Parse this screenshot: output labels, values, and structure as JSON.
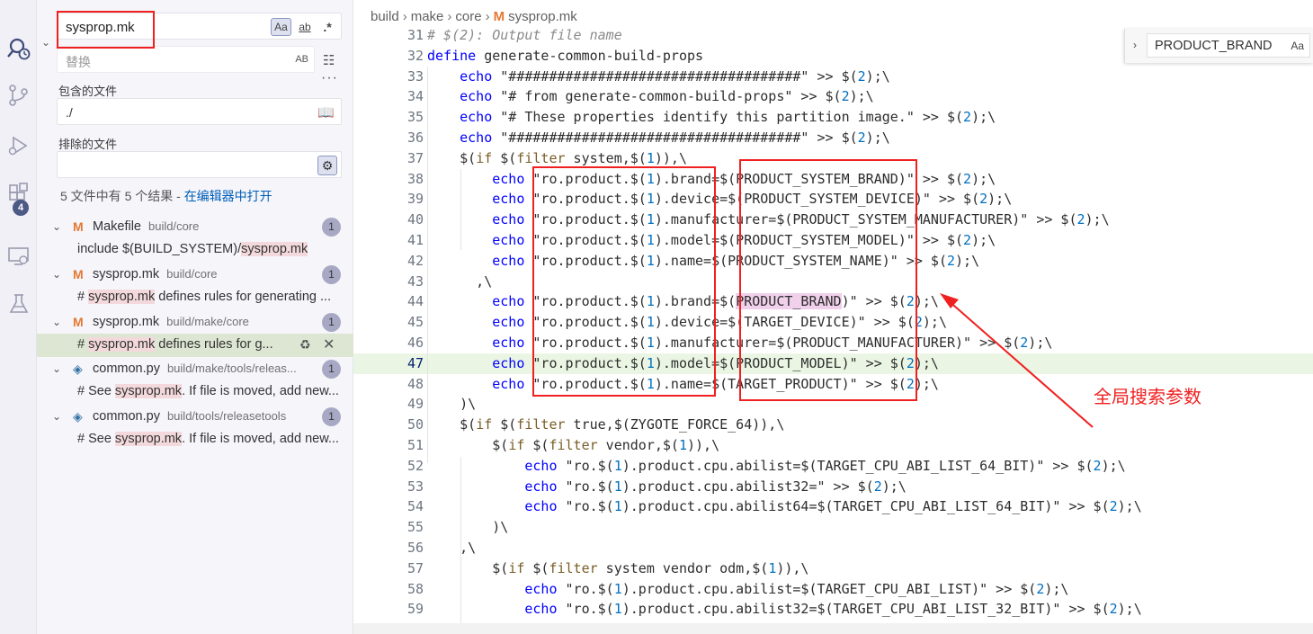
{
  "search": {
    "query": "sysprop.mk",
    "match_case_label": "Aa",
    "whole_word_label": "ab",
    "regex_label": ".*",
    "replace_placeholder": "替换",
    "preserve_case_label": "AB",
    "includes_label": "包含的文件",
    "includes_value": "./",
    "excludes_label": "排除的文件",
    "excludes_value": "",
    "summary_prefix": "5 文件中有 5 个结果 - ",
    "open_in_editor_label": "在编辑器中打开"
  },
  "activity_bar": {
    "icons": [
      "search-icon",
      "source-control-icon",
      "run-debug-icon",
      "extensions-icon",
      "remote-explorer-icon",
      "testing-icon"
    ],
    "extensions_badge": "4"
  },
  "results": [
    {
      "file": "Makefile",
      "path": "build/core",
      "count": "1",
      "type": "mk",
      "match_before": "include $(BUILD_SYSTEM)/",
      "match_hit": "sysprop.mk",
      "match_after": ""
    },
    {
      "file": "sysprop.mk",
      "path": "build/core",
      "count": "1",
      "type": "mk",
      "match_before": "# ",
      "match_hit": "sysprop.mk",
      "match_after": " defines rules for generating ..."
    },
    {
      "file": "sysprop.mk",
      "path": "build/make/core",
      "count": "1",
      "type": "mk",
      "match_before": "# ",
      "match_hit": "sysprop.mk",
      "match_after": " defines rules for g..."
    },
    {
      "file": "common.py",
      "path": "build/make/tools/releas...",
      "count": "1",
      "type": "py",
      "match_before": "# See ",
      "match_hit": "sysprop.mk",
      "match_after": ". If file is moved, add new..."
    },
    {
      "file": "common.py",
      "path": "build/tools/releasetools",
      "count": "1",
      "type": "py",
      "match_before": "# See ",
      "match_hit": "sysprop.mk",
      "match_after": ". If file is moved, add new..."
    }
  ],
  "breadcrumb": [
    "build",
    "make",
    "core",
    "sysprop.mk"
  ],
  "find_widget": {
    "value": "PRODUCT_BRAND",
    "match_case_label": "Aa"
  },
  "annotation": {
    "text": "全局搜索参数",
    "color": "#f02020"
  },
  "current_line": "47",
  "code_lines": [
    {
      "n": "31",
      "text": "# $(2): Output file name"
    },
    {
      "n": "32",
      "text": "define generate-common-build-props"
    },
    {
      "n": "33",
      "text": "    echo \"####################################\" >> $(2);\\"
    },
    {
      "n": "34",
      "text": "    echo \"# from generate-common-build-props\" >> $(2);\\"
    },
    {
      "n": "35",
      "text": "    echo \"# These properties identify this partition image.\" >> $(2);\\"
    },
    {
      "n": "36",
      "text": "    echo \"####################################\" >> $(2);\\"
    },
    {
      "n": "37",
      "text": "    $(if $(filter system,$(1)),\\"
    },
    {
      "n": "38",
      "text": "        echo \"ro.product.$(1).brand=$(PRODUCT_SYSTEM_BRAND)\" >> $(2);\\"
    },
    {
      "n": "39",
      "text": "        echo \"ro.product.$(1).device=$(PRODUCT_SYSTEM_DEVICE)\" >> $(2);\\"
    },
    {
      "n": "40",
      "text": "        echo \"ro.product.$(1).manufacturer=$(PRODUCT_SYSTEM_MANUFACTURER)\" >> $(2);\\"
    },
    {
      "n": "41",
      "text": "        echo \"ro.product.$(1).model=$(PRODUCT_SYSTEM_MODEL)\" >> $(2);\\"
    },
    {
      "n": "42",
      "text": "        echo \"ro.product.$(1).name=$(PRODUCT_SYSTEM_NAME)\" >> $(2);\\"
    },
    {
      "n": "43",
      "text": "      ,\\"
    },
    {
      "n": "44",
      "text": "        echo \"ro.product.$(1).brand=$(PRODUCT_BRAND)\" >> $(2);\\"
    },
    {
      "n": "45",
      "text": "        echo \"ro.product.$(1).device=$(TARGET_DEVICE)\" >> $(2);\\"
    },
    {
      "n": "46",
      "text": "        echo \"ro.product.$(1).manufacturer=$(PRODUCT_MANUFACTURER)\" >> $(2);\\"
    },
    {
      "n": "47",
      "text": "        echo \"ro.product.$(1).model=$(PRODUCT_MODEL)\" >> $(2);\\"
    },
    {
      "n": "48",
      "text": "        echo \"ro.product.$(1).name=$(TARGET_PRODUCT)\" >> $(2);\\"
    },
    {
      "n": "49",
      "text": "    )\\"
    },
    {
      "n": "50",
      "text": "    $(if $(filter true,$(ZYGOTE_FORCE_64)),\\"
    },
    {
      "n": "51",
      "text": "        $(if $(filter vendor,$(1)),\\"
    },
    {
      "n": "52",
      "text": "            echo \"ro.$(1).product.cpu.abilist=$(TARGET_CPU_ABI_LIST_64_BIT)\" >> $(2);\\"
    },
    {
      "n": "53",
      "text": "            echo \"ro.$(1).product.cpu.abilist32=\" >> $(2);\\"
    },
    {
      "n": "54",
      "text": "            echo \"ro.$(1).product.cpu.abilist64=$(TARGET_CPU_ABI_LIST_64_BIT)\" >> $(2);\\"
    },
    {
      "n": "55",
      "text": "        )\\"
    },
    {
      "n": "56",
      "text": "    ,\\"
    },
    {
      "n": "57",
      "text": "        $(if $(filter system vendor odm,$(1)),\\"
    },
    {
      "n": "58",
      "text": "            echo \"ro.$(1).product.cpu.abilist=$(TARGET_CPU_ABI_LIST)\" >> $(2);\\"
    },
    {
      "n": "59",
      "text": "            echo \"ro.$(1).product.cpu.abilist32=$(TARGET_CPU_ABI_LIST_32_BIT)\" >> $(2);\\"
    }
  ]
}
